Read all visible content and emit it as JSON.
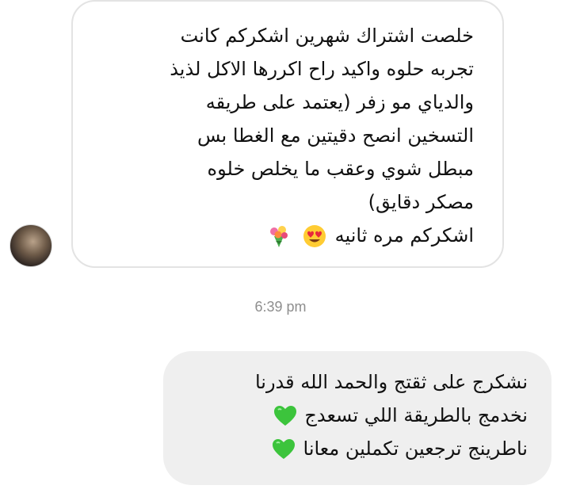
{
  "incoming": {
    "lines": [
      "خلصت اشتراك شهرين اشكركم كانت",
      "تجربه حلوه واكيد راح اكررها الاكل لذيذ",
      "والدياي مو زفر (يعتمد على طريقه",
      "التسخين انصح دقيتين مع الغطا بس",
      "مبطل شوي وعقب ما يخلص خلوه",
      "مصكر دقايق)",
      "اشكركم مره ثانيه"
    ],
    "emojis": [
      "heart-eyes-emoji",
      "bouquet-emoji"
    ]
  },
  "timestamp": "6:39 pm",
  "outgoing": {
    "lines": [
      "نشكرج على ثقتج والحمد الله قدرنا",
      "نخدمج بالطريقة اللي تسعدج",
      "ناطرينج ترجعين تكملين معانا"
    ],
    "emojis": [
      "green-heart-emoji",
      "green-heart-emoji"
    ]
  },
  "colors": {
    "incoming_border": "#e3e3e3",
    "outgoing_bg": "#efefef",
    "timestamp": "#8e8e8e",
    "green_heart": "#3cc43c"
  }
}
